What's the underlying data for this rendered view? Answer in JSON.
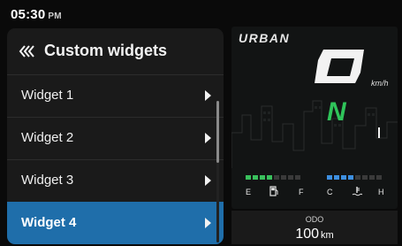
{
  "status": {
    "time": "05:30",
    "ampm": "PM"
  },
  "menu": {
    "title": "Custom widgets",
    "items": [
      {
        "label": "Widget 1",
        "selected": false
      },
      {
        "label": "Widget 2",
        "selected": false
      },
      {
        "label": "Widget 3",
        "selected": false
      },
      {
        "label": "Widget 4",
        "selected": true
      }
    ]
  },
  "cluster": {
    "mode": "URBAN",
    "speed_unit": "km/h",
    "gear": "N",
    "fuel": {
      "low_label": "E",
      "high_label": "F",
      "level_fraction": 0.5
    },
    "temp": {
      "low_label": "C",
      "high_label": "H",
      "level_fraction": 0.5
    },
    "colors": {
      "gear": "#2fc45a",
      "fuel_bar": "#39c05c",
      "temp_bar": "#3d8fe0",
      "selected_item": "#1f6eaa"
    }
  },
  "odo": {
    "label": "ODO",
    "value": "100",
    "unit": "km"
  }
}
